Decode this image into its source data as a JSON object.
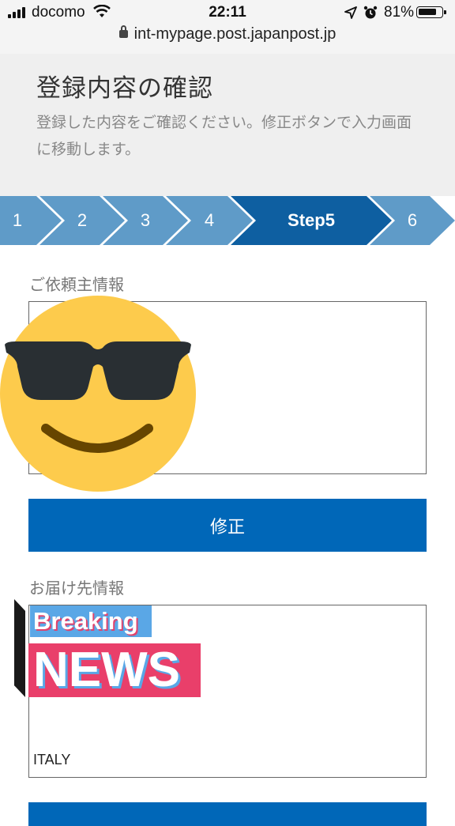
{
  "status_bar": {
    "carrier": "docomo",
    "time": "22:11",
    "battery": "81%",
    "battery_level": 0.81
  },
  "url_bar": {
    "url": "int-mypage.post.japanpost.jp"
  },
  "header": {
    "title": "登録内容の確認",
    "description": "登録した内容をご確認ください。修正ボタンで入力画面に移動します。"
  },
  "steps": [
    {
      "label": "1"
    },
    {
      "label": "2"
    },
    {
      "label": "3"
    },
    {
      "label": "4"
    },
    {
      "label": "Step5",
      "active": true
    },
    {
      "label": "6"
    }
  ],
  "colors": {
    "step_inactive": "#5f9bc8",
    "step_active": "#0e5fa1",
    "button": "#0067b8"
  },
  "sender": {
    "label": "ご依頼主情報",
    "button": "修正"
  },
  "recipient": {
    "label": "お届け先情報",
    "country": "ITALY"
  },
  "overlays": {
    "sticker_emoji": "smiling-face-with-sunglasses",
    "sticker_breaking": "Breaking",
    "sticker_news": "NEWS"
  }
}
